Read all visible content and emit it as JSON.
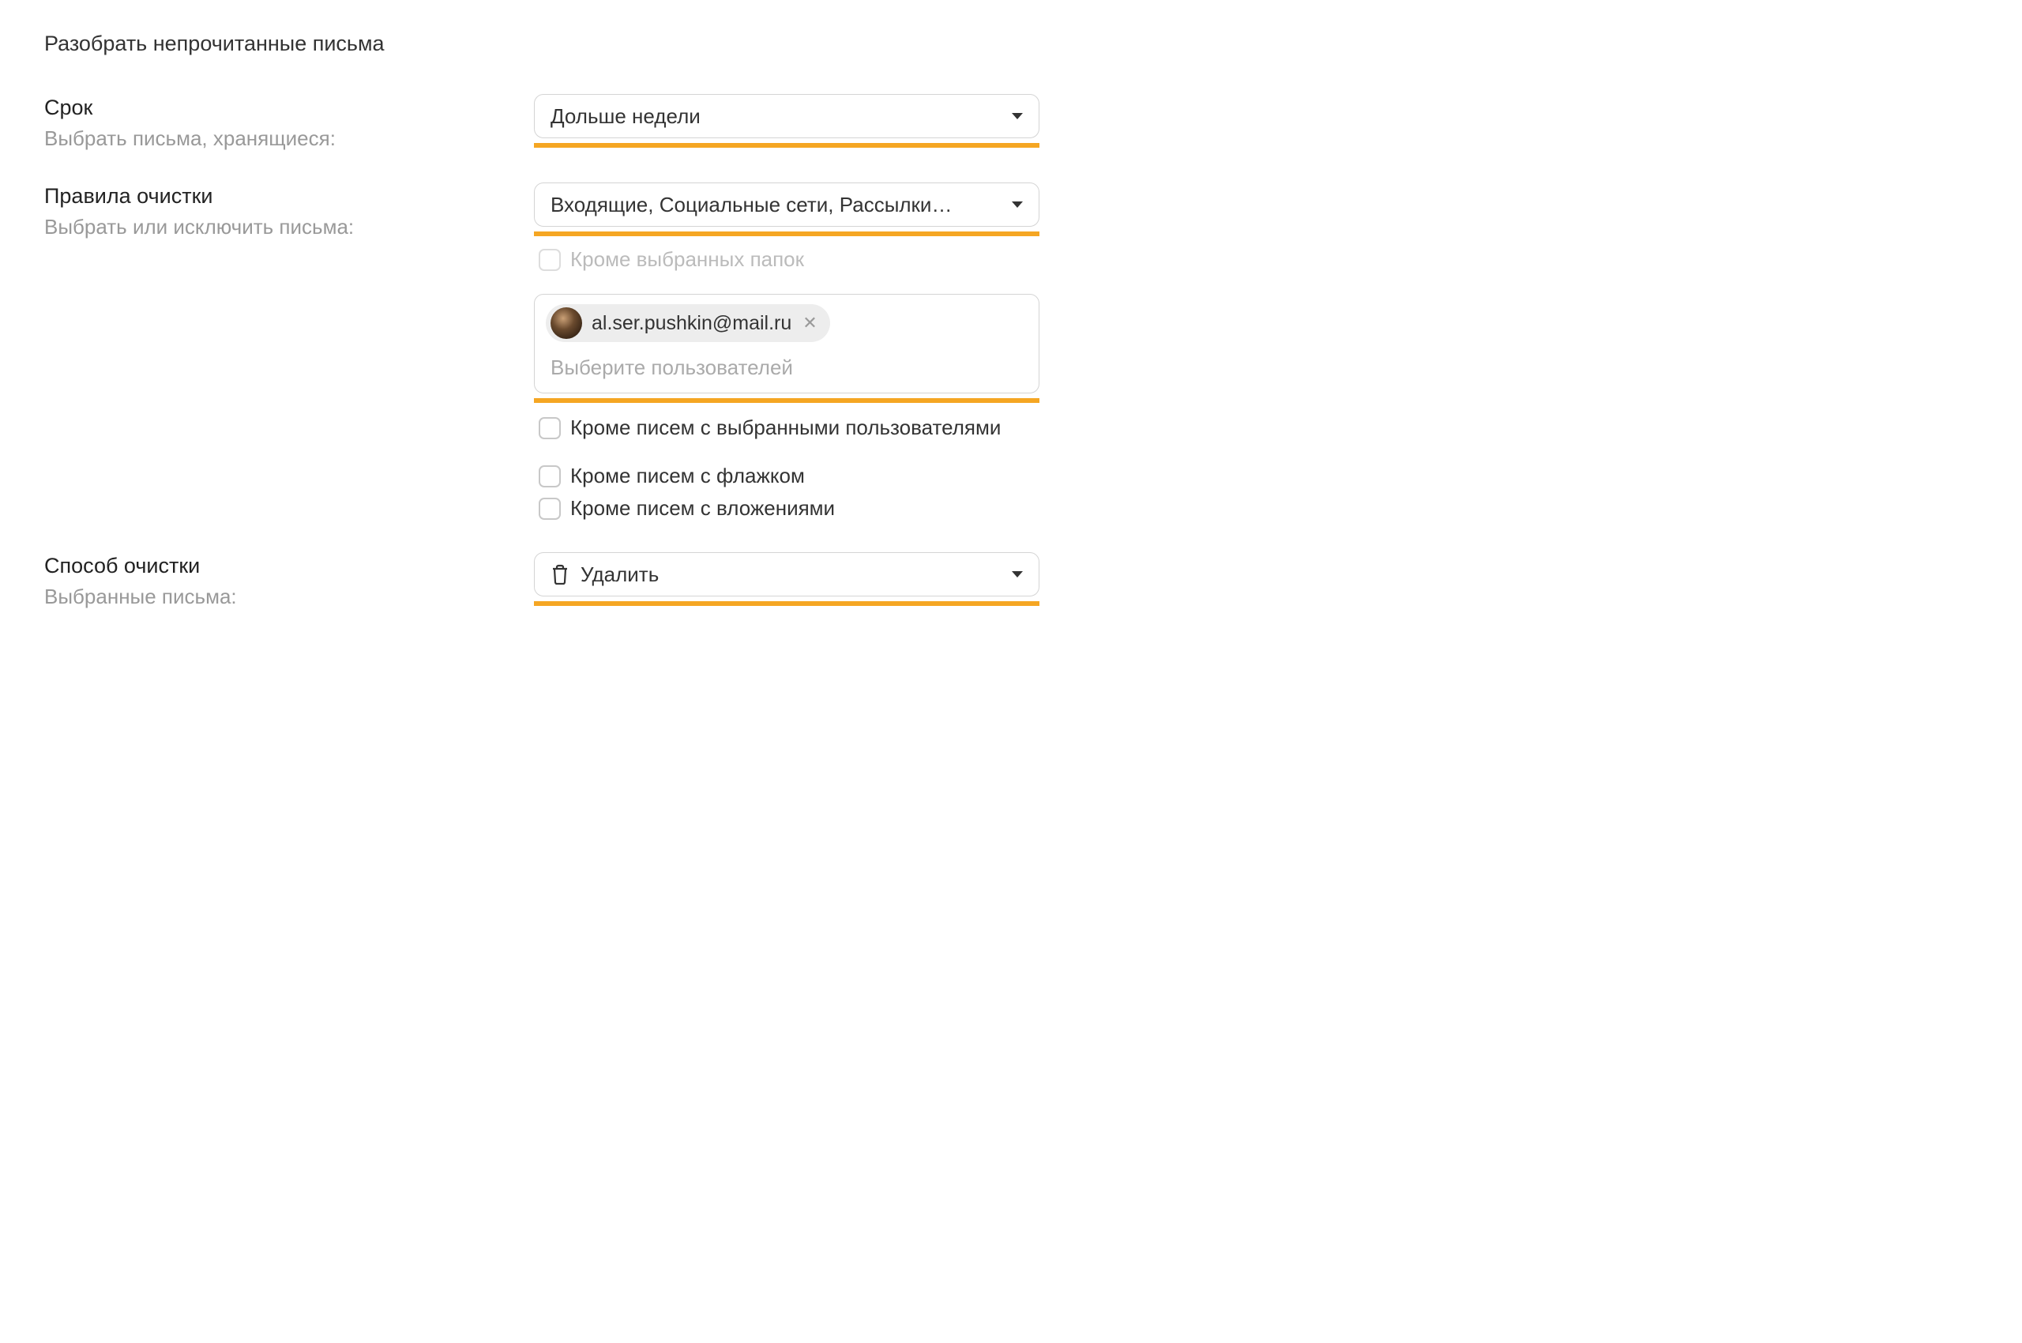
{
  "page": {
    "title": "Разобрать непрочитанные письма"
  },
  "period": {
    "heading": "Срок",
    "sub": "Выбрать письма, хранящиеся:",
    "select_value": "Дольше недели"
  },
  "rules": {
    "heading": "Правила очистки",
    "sub": "Выбрать или исключить письма:",
    "folders_select_value": "Входящие, Социальные сети, Рассылки…",
    "except_folders_label": "Кроме выбранных папок",
    "user_chip_email": "al.ser.pushkin@mail.ru",
    "user_placeholder": "Выберите пользователей",
    "except_users_label": "Кроме писем с выбранными пользователями",
    "except_flag_label": "Кроме писем с флажком",
    "except_attach_label": "Кроме писем с вложениями"
  },
  "method": {
    "heading": "Способ очистки",
    "sub": "Выбранные письма:",
    "select_value": "Удалить"
  }
}
